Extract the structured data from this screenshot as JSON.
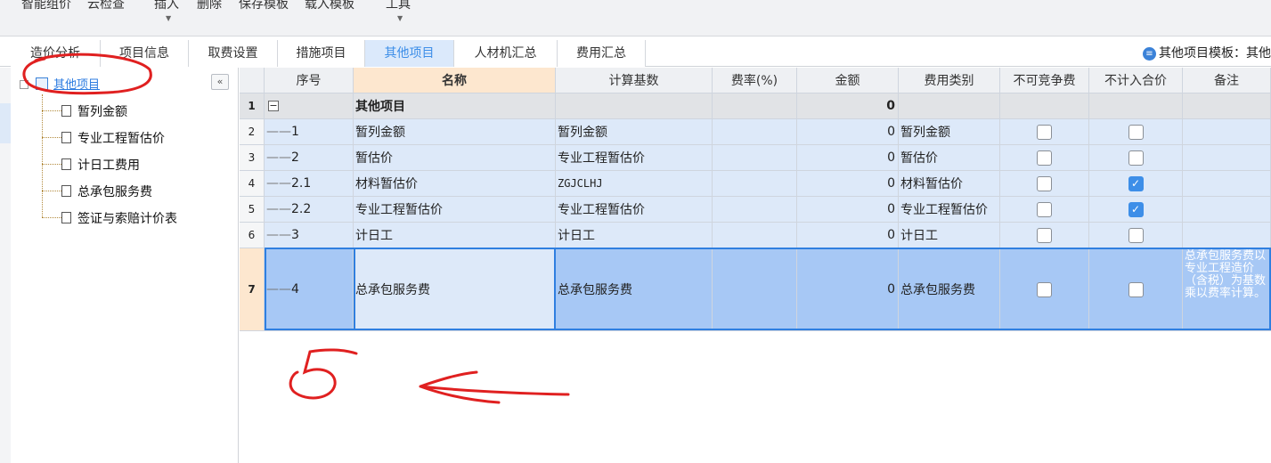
{
  "toolbar": {
    "items": [
      "智能组价",
      "云检查",
      "插入",
      "删除",
      "保存模板",
      "载入模板",
      "工具"
    ]
  },
  "tabs": [
    "造价分析",
    "项目信息",
    "取费设置",
    "措施项目",
    "其他项目",
    "人材机汇总",
    "费用汇总"
  ],
  "active_tab": "其他项目",
  "template_label": "其他项目模板：其他",
  "tree": {
    "root": "其他项目",
    "items": [
      "暂列金额",
      "专业工程暂估价",
      "计日工费用",
      "总承包服务费",
      "签证与索赔计价表"
    ]
  },
  "grid": {
    "headers": [
      "序号",
      "名称",
      "计算基数",
      "费率(%)",
      "金额",
      "费用类别",
      "不可竞争费",
      "不计入合价",
      "备注"
    ],
    "rows": [
      {
        "num": "1",
        "seq": "",
        "name": "其他项目",
        "base": "",
        "rate": "",
        "amount": "0",
        "category": "",
        "nc": null,
        "ex": null,
        "note": ""
      },
      {
        "num": "2",
        "seq": "1",
        "name": "暂列金额",
        "base": "暂列金额",
        "rate": "",
        "amount": "0",
        "category": "暂列金额",
        "nc": false,
        "ex": false,
        "note": ""
      },
      {
        "num": "3",
        "seq": "2",
        "name": "暂估价",
        "base": "专业工程暂估价",
        "rate": "",
        "amount": "0",
        "category": "暂估价",
        "nc": false,
        "ex": false,
        "note": ""
      },
      {
        "num": "4",
        "seq": "2.1",
        "name": "材料暂估价",
        "base": "ZGJCLHJ",
        "rate": "",
        "amount": "0",
        "category": "材料暂估价",
        "nc": false,
        "ex": true,
        "note": ""
      },
      {
        "num": "5",
        "seq": "2.2",
        "name": "专业工程暂估价",
        "base": "专业工程暂估价",
        "rate": "",
        "amount": "0",
        "category": "专业工程暂估价",
        "nc": false,
        "ex": true,
        "note": ""
      },
      {
        "num": "6",
        "seq": "3",
        "name": "计日工",
        "base": "计日工",
        "rate": "",
        "amount": "0",
        "category": "计日工",
        "nc": false,
        "ex": false,
        "note": ""
      },
      {
        "num": "7",
        "seq": "4",
        "name": "总承包服务费",
        "base": "总承包服务费",
        "rate": "",
        "amount": "0",
        "category": "总承包服务费",
        "nc": false,
        "ex": false,
        "note": "总承包服务费以专业工程造价（含税）为基数乘以费率计算。"
      }
    ]
  },
  "annotation": {
    "digit": "5",
    "color": "#e02020"
  }
}
